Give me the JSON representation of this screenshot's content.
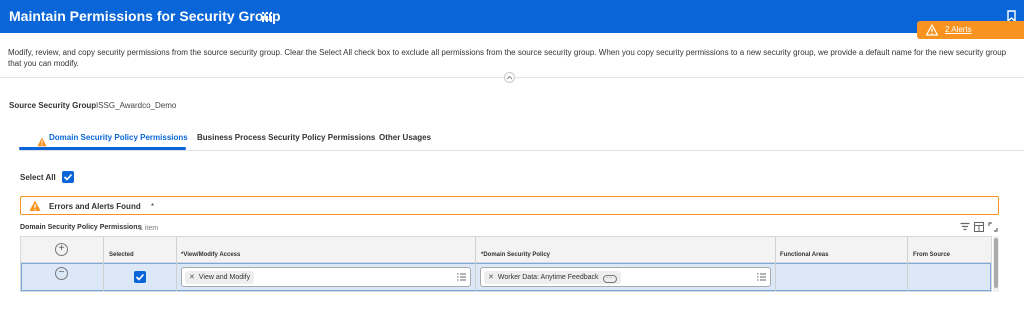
{
  "header": {
    "title": "Maintain Permissions for Security Group",
    "alerts_label": "2 Alerts",
    "colors": {
      "bar": "#0a66d8",
      "alert": "#f7931e"
    }
  },
  "description": "Modify, review, and copy security permissions from the source security group. Clear the Select All check box to exclude all permissions from the source security group. When you copy security permissions to a new security group, we provide a default name for the new security group that you can modify.",
  "source": {
    "label": "Source Security Group",
    "value": "ISSG_Awardco_Demo"
  },
  "tabs": [
    {
      "label": "Domain Security Policy Permissions",
      "active": true,
      "icon": "warning-icon"
    },
    {
      "label": "Business Process Security Policy Permissions",
      "active": false
    },
    {
      "label": "Other Usages",
      "active": false
    }
  ],
  "select_all": {
    "label": "Select All",
    "checked": true
  },
  "errors": {
    "label": "Errors and Alerts Found",
    "marker": "*"
  },
  "grid": {
    "title": "Domain Security Policy Permissions",
    "count": "1 item",
    "columns": [
      "Selected",
      "*View/Modify Access",
      "*Domain Security Policy",
      "Functional Areas",
      "From Source"
    ],
    "rows": [
      {
        "selected": true,
        "view_modify": "View and Modify",
        "domain_policy": "Worker Data: Anytime Feedback",
        "functional_areas": "",
        "from_source": ""
      }
    ]
  }
}
